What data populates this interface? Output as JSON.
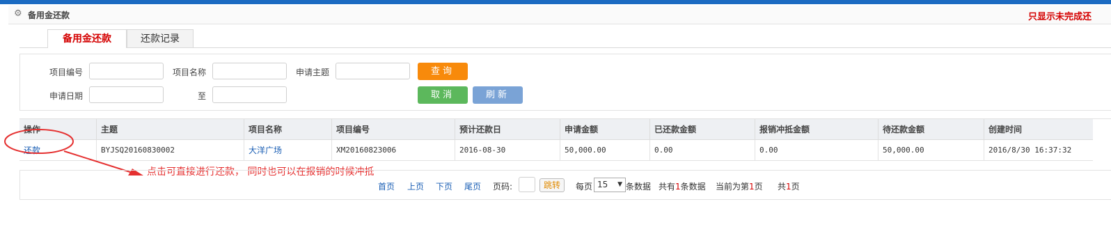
{
  "header": {
    "gear_icon": "gear-icon",
    "title": "备用金还款",
    "notice": "只显示未完成还"
  },
  "tabs": [
    {
      "label": "备用金还款",
      "active": true
    },
    {
      "label": "还款记录",
      "active": false
    }
  ],
  "search": {
    "project_no_label": "项目编号",
    "project_name_label": "项目名称",
    "subject_label": "申请主题",
    "date_label": "申请日期",
    "to_label": "至",
    "query_button": "查询",
    "cancel_button": "取消",
    "refresh_button": "刷新",
    "colors": {
      "query": "#f88a0b",
      "cancel": "#5cb85c",
      "refresh": "#7aa3d6"
    }
  },
  "table": {
    "columns": [
      "操作",
      "主题",
      "项目名称",
      "项目编号",
      "预计还款日",
      "申请金额",
      "已还款金额",
      "报销冲抵金额",
      "待还款金额",
      "创建时间"
    ],
    "rows": [
      {
        "action": "还款",
        "subject": "BYJSQ20160830002",
        "project_name": "大洋广场",
        "project_no": "XM20160823006",
        "expected_date": "2016-08-30",
        "apply_amount": "50,000.00",
        "repaid_amount": "0.00",
        "offset_amount": "0.00",
        "pending_amount": "50,000.00",
        "created_time": "2016/8/30 16:37:32"
      }
    ]
  },
  "annotation": {
    "text": "点击可直接进行还款， 同时也可以在报销的时候冲抵",
    "color": "#e53030"
  },
  "pager": {
    "first": "首页",
    "prev": "上页",
    "next": "下页",
    "last": "尾页",
    "page_label": "页码:",
    "jump": "跳转",
    "per_page_prefix": "每页",
    "per_page_value": "15",
    "per_page_suffix": "条数据",
    "total_prefix": "共有",
    "total_count": "1",
    "total_suffix": "条数据",
    "current_prefix": "当前为第",
    "current_page": "1",
    "current_suffix": "页",
    "pages_prefix": "共",
    "pages_total": "1",
    "pages_suffix": "页"
  }
}
